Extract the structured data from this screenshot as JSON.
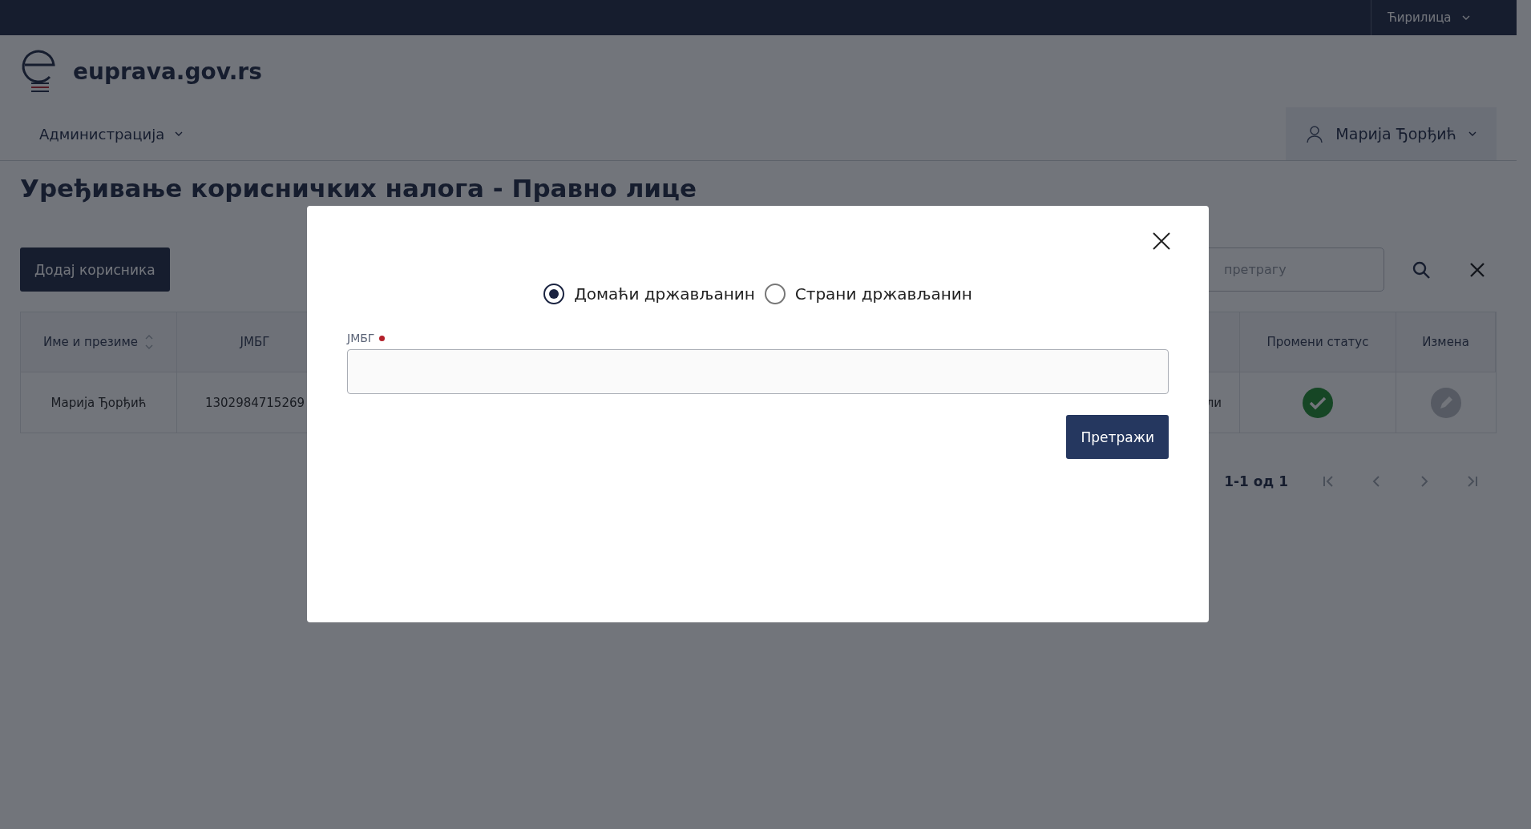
{
  "top_bar": {
    "language": "Ћирилица"
  },
  "header": {
    "site_name": "euprava.gov.rs",
    "nav": [
      {
        "label": "Администрација"
      }
    ],
    "user": {
      "name": "Марија Ђорђић"
    }
  },
  "page": {
    "title": "Уређивање корисничких налога - Правно лице",
    "add_button": "Додај корисника",
    "search": {
      "placeholder": "претрагу"
    },
    "table": {
      "columns": [
        {
          "label": "Име и презиме",
          "sortable": true
        },
        {
          "label": "ЈМБГ"
        },
        {},
        {
          "label": "Промени статус"
        },
        {
          "label": "Измена"
        }
      ],
      "rows": [
        {
          "name": "Марија Ђорђић",
          "jmbg": "1302984715269",
          "column_3": "ли",
          "active": true,
          "edit_disabled": true
        }
      ]
    },
    "pagination": {
      "range": "1-1 од 1",
      "buttons": [
        {
          "kind": "first",
          "disabled": true
        },
        {
          "kind": "prev",
          "disabled": true
        },
        {
          "kind": "next",
          "disabled": true
        },
        {
          "kind": "last",
          "disabled": true
        }
      ]
    }
  },
  "modal": {
    "options": [
      {
        "label": "Домаћи држављанин",
        "selected": true
      },
      {
        "label": "Страни држављанин",
        "selected": false
      }
    ],
    "field": {
      "label": "ЈМБГ",
      "required": true
    },
    "submit": "Претражи"
  }
}
